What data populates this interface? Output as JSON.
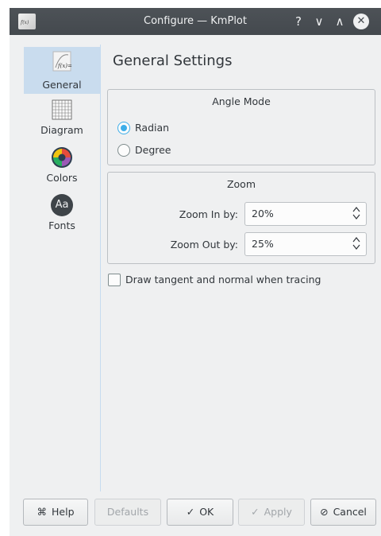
{
  "window": {
    "title": "Configure — KmPlot",
    "help_glyph": "?",
    "minimize_glyph": "∨",
    "maximize_glyph": "∧",
    "close_glyph": "✕"
  },
  "sidebar": {
    "items": [
      {
        "label": "General",
        "icon": "function-plot-icon",
        "active": true
      },
      {
        "label": "Diagram",
        "icon": "grid-icon",
        "active": false
      },
      {
        "label": "Colors",
        "icon": "color-wheel-icon",
        "active": false
      },
      {
        "label": "Fonts",
        "icon": "fonts-icon",
        "active": false
      }
    ],
    "fonts_icon_text": "Aa"
  },
  "page": {
    "title": "General Settings"
  },
  "angle_mode": {
    "title": "Angle Mode",
    "options": [
      {
        "label": "Radian",
        "checked": true
      },
      {
        "label": "Degree",
        "checked": false
      }
    ]
  },
  "zoom": {
    "title": "Zoom",
    "zoom_in_label": "Zoom In by:",
    "zoom_in_value": "20%",
    "zoom_out_label": "Zoom Out by:",
    "zoom_out_value": "25%"
  },
  "tangent": {
    "label": "Draw tangent and normal when tracing",
    "checked": false
  },
  "buttons": {
    "help": "Help",
    "defaults": "Defaults",
    "ok": "OK",
    "apply": "Apply",
    "cancel": "Cancel"
  },
  "colors": {
    "accent": "#3daee9",
    "titlebar": "#474c51",
    "selection": "#c9dcee"
  }
}
